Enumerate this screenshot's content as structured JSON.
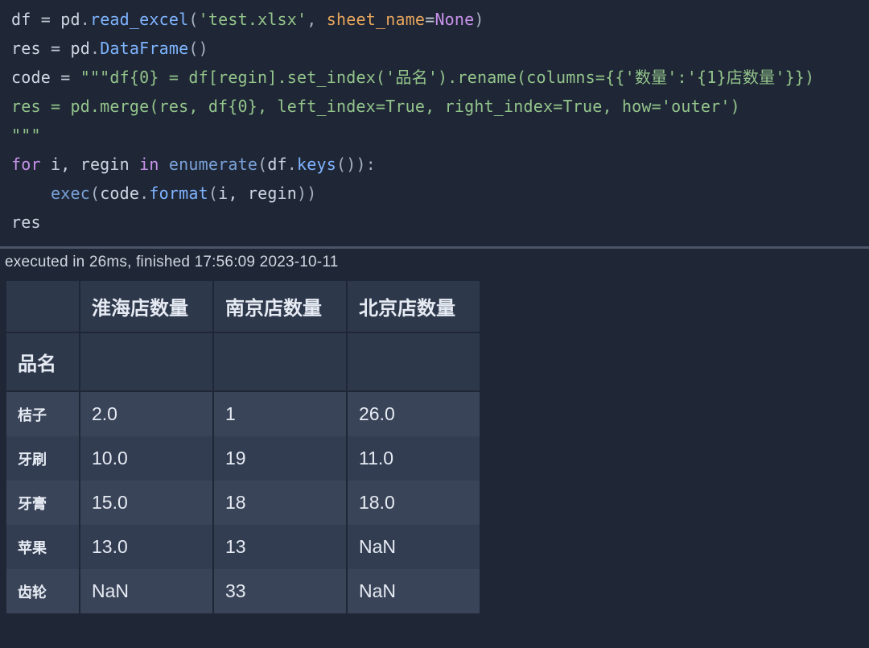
{
  "code": {
    "l1": {
      "a": "df ",
      "eq": "= ",
      "pd": "pd",
      "dot1": ".",
      "fn": "read_excel",
      "op": "(",
      "s": "'test.xlsx'",
      "comma": ", ",
      "kw": "sheet_name",
      "eq2": "=",
      "none": "None",
      "cp": ")"
    },
    "l2": {
      "a": "res ",
      "eq": "= ",
      "pd": "pd",
      "dot": ".",
      "fn": "DataFrame",
      "par": "()"
    },
    "l3": {
      "a": "code ",
      "eq": "= ",
      "s": "\"\"\"df{0} = df[regin].set_index('品名').rename(columns={{'数量':'{1}店数量'}})"
    },
    "l4": {
      "s": "res = pd.merge(res, df{0}, left_index=True, right_index=True, how='outer')"
    },
    "l5": {
      "s": "\"\"\""
    },
    "l6": {
      "for": "for",
      "vars": " i, regin ",
      "in": "in",
      "sp": " ",
      "enum": "enumerate",
      "op": "(",
      "df": "df",
      "dot": ".",
      "keys": "keys",
      "par": "()",
      "cp": ")",
      "colon": ":"
    },
    "l7": {
      "indent": "    ",
      "exec": "exec",
      "op": "(",
      "code": "code",
      "dot": ".",
      "fmt": "format",
      "op2": "(",
      "args": "i, regin",
      "cp2": ")",
      "cp": ")"
    },
    "l8": {
      "a": "res"
    }
  },
  "exec_info": "executed in 26ms, finished 17:56:09 2023-10-11",
  "table": {
    "index_name": "品名",
    "columns": [
      "淮海店数量",
      "南京店数量",
      "北京店数量"
    ],
    "rows": [
      {
        "idx": "桔子",
        "c": [
          "2.0",
          "1",
          "26.0"
        ]
      },
      {
        "idx": "牙刷",
        "c": [
          "10.0",
          "19",
          "11.0"
        ]
      },
      {
        "idx": "牙膏",
        "c": [
          "15.0",
          "18",
          "18.0"
        ]
      },
      {
        "idx": "苹果",
        "c": [
          "13.0",
          "13",
          "NaN"
        ]
      },
      {
        "idx": "齿轮",
        "c": [
          "NaN",
          "33",
          "NaN"
        ]
      }
    ]
  }
}
